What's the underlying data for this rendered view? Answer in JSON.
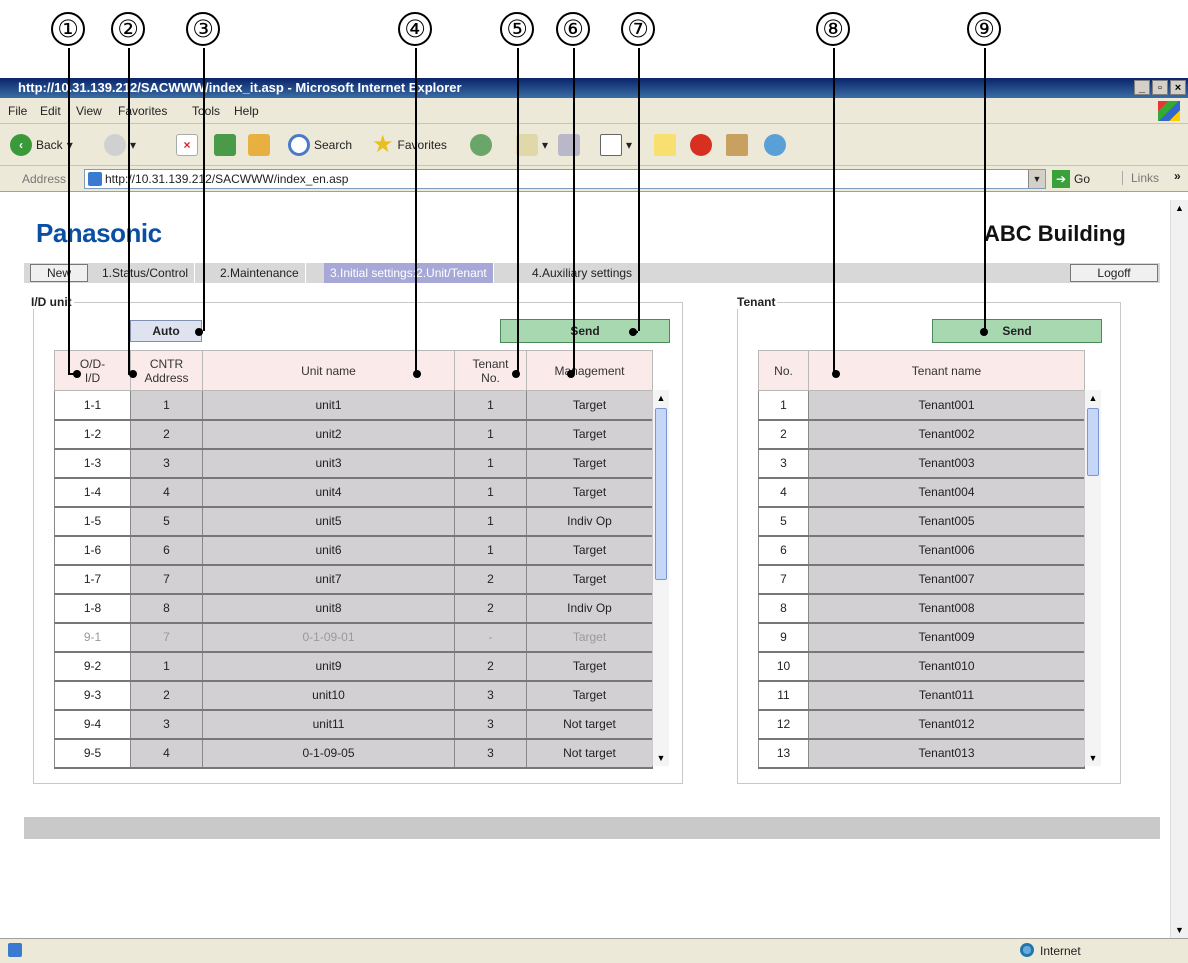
{
  "callouts": [
    "①",
    "②",
    "③",
    "④",
    "⑤",
    "⑥",
    "⑦",
    "⑧",
    "⑨"
  ],
  "browser": {
    "title": "http://10.31.139.212/SACWWW/index_it.asp - Microsoft Internet Explorer",
    "menu": [
      "File",
      "Edit",
      "View",
      "Favorites",
      "Tools",
      "Help"
    ],
    "toolbar": {
      "back": "Back",
      "search": "Search",
      "favorites": "Favorites"
    },
    "address_label": "Address",
    "address": "http://10.31.139.212/SACWWW/index_en.asp",
    "go": "Go",
    "links": "Links",
    "status_zone": "Internet"
  },
  "header": {
    "logo": "Panasonic",
    "building": "ABC Building"
  },
  "nav": {
    "new": "New",
    "tabs": [
      "1.Status/Control",
      "2.Maintenance",
      "3.Initial settings:2.Unit/Tenant",
      "4.Auxiliary settings"
    ],
    "active_tab": 2,
    "logoff": "Logoff"
  },
  "idunit": {
    "legend": "I/D unit",
    "auto": "Auto",
    "send": "Send",
    "columns": [
      "O/D-\nI/D",
      "CNTR\nAddress",
      "Unit name",
      "Tenant\nNo.",
      "Management"
    ],
    "rows": [
      [
        "1-1",
        "1",
        "unit1",
        "1",
        "Target"
      ],
      [
        "1-2",
        "2",
        "unit2",
        "1",
        "Target"
      ],
      [
        "1-3",
        "3",
        "unit3",
        "1",
        "Target"
      ],
      [
        "1-4",
        "4",
        "unit4",
        "1",
        "Target"
      ],
      [
        "1-5",
        "5",
        "unit5",
        "1",
        "Indiv Op"
      ],
      [
        "1-6",
        "6",
        "unit6",
        "1",
        "Target"
      ],
      [
        "1-7",
        "7",
        "unit7",
        "2",
        "Target"
      ],
      [
        "1-8",
        "8",
        "unit8",
        "2",
        "Indiv Op"
      ],
      [
        "9-1",
        "7",
        "0-1-09-01",
        "-",
        "Target"
      ],
      [
        "9-2",
        "1",
        "unit9",
        "2",
        "Target"
      ],
      [
        "9-3",
        "2",
        "unit10",
        "3",
        "Target"
      ],
      [
        "9-4",
        "3",
        "unit11",
        "3",
        "Not target"
      ],
      [
        "9-5",
        "4",
        "0-1-09-05",
        "3",
        "Not target"
      ]
    ],
    "dim_row": 8
  },
  "tenant": {
    "legend": "Tenant",
    "send": "Send",
    "columns": [
      "No.",
      "Tenant name"
    ],
    "rows": [
      [
        "1",
        "Tenant001"
      ],
      [
        "2",
        "Tenant002"
      ],
      [
        "3",
        "Tenant003"
      ],
      [
        "4",
        "Tenant004"
      ],
      [
        "5",
        "Tenant005"
      ],
      [
        "6",
        "Tenant006"
      ],
      [
        "7",
        "Tenant007"
      ],
      [
        "8",
        "Tenant008"
      ],
      [
        "9",
        "Tenant009"
      ],
      [
        "10",
        "Tenant010"
      ],
      [
        "11",
        "Tenant011"
      ],
      [
        "12",
        "Tenant012"
      ],
      [
        "13",
        "Tenant013"
      ]
    ]
  }
}
